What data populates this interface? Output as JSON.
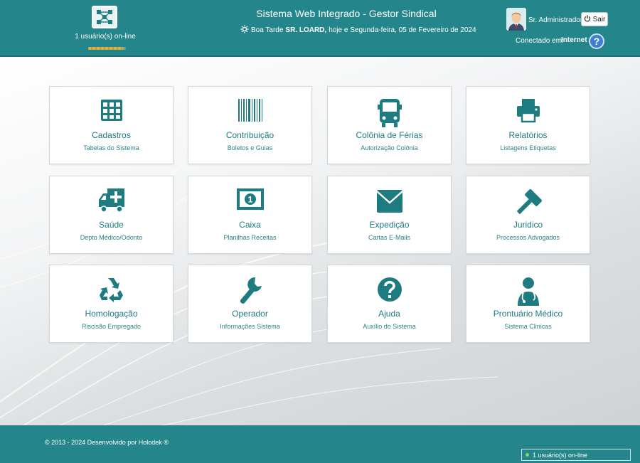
{
  "header": {
    "online_count_top": "1 usuário(s) on-line",
    "online_bar_fraction": 0.93,
    "app_title": "Sistema Web Integrado - Gestor Sindical",
    "greeting_prefix": "Boa Tarde",
    "greeting_user": "SR. LOARD,",
    "greeting_suffix": "hoje e Segunda-feira, 05 de Fevereiro de 2024",
    "user_name": "Sr. Administrador",
    "logout_label": "Sair",
    "connection_label": "Conectado em:",
    "connection_value": "Internet",
    "help_label": "?"
  },
  "tiles": [
    {
      "title": "Cadastros",
      "subtitle": "Tabelas do Sistema",
      "icon": "table-grid-icon"
    },
    {
      "title": "Contribuição",
      "subtitle": "Boletos e Guias",
      "icon": "barcode-icon"
    },
    {
      "title": "Colônia de Férias",
      "subtitle": "Autorização Colônia",
      "icon": "bus-icon"
    },
    {
      "title": "Relatórios",
      "subtitle": "Listagens Etiquetas",
      "icon": "printer-icon"
    },
    {
      "title": "Saúde",
      "subtitle": "Depto Médico/Odonto",
      "icon": "ambulance-icon"
    },
    {
      "title": "Caixa",
      "subtitle": "Planilhas Receitas",
      "icon": "banknote-icon"
    },
    {
      "title": "Expedição",
      "subtitle": "Cartas E-Mails",
      "icon": "envelope-icon"
    },
    {
      "title": "Juridico",
      "subtitle": "Processos Advogados",
      "icon": "gavel-icon"
    },
    {
      "title": "Homologação",
      "subtitle": "Riscisão Empregado",
      "icon": "recycle-icon"
    },
    {
      "title": "Operador",
      "subtitle": "Informações Sistema",
      "icon": "wrench-icon"
    },
    {
      "title": "Ajuda",
      "subtitle": "Auxílio do Sistema",
      "icon": "question-circle-icon"
    },
    {
      "title": "Prontuário Médico",
      "subtitle": "Sistema Clinicas",
      "icon": "doctor-icon"
    }
  ],
  "footer": {
    "copyright": "© 2013 - 2024 Desenvolvido por Holodek ®",
    "online_count_bottom": "1 usuário(s) on-line"
  },
  "colors": {
    "brand": "#24868a",
    "icon": "#1e7c80",
    "online_dot": "#7dd95f",
    "help_button": "#3f7fd0"
  }
}
